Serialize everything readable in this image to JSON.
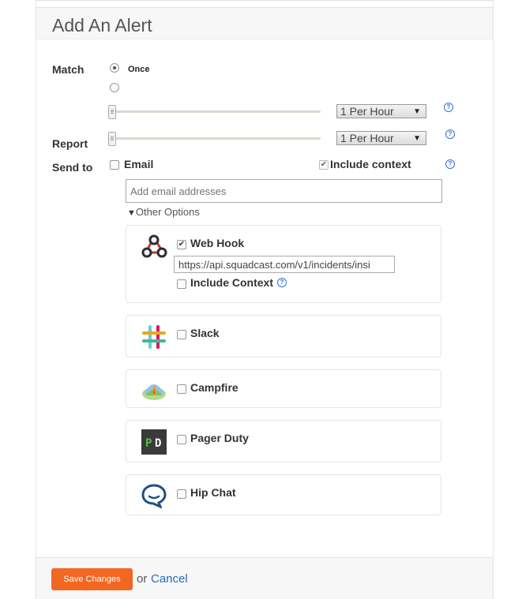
{
  "page": {
    "title": "Add An Alert"
  },
  "match": {
    "label": "Match",
    "option_once": "Once",
    "selected": "once",
    "frequency": "1 Per Hour"
  },
  "report": {
    "label": "Report",
    "frequency": "1 Per Hour"
  },
  "send_to": {
    "label": "Send to",
    "email_label": "Email",
    "include_context_label": "Include context",
    "email_placeholder": "Add email addresses",
    "other_options_label": "Other Options"
  },
  "integrations": {
    "webhook": {
      "name": "Web Hook",
      "checked": true,
      "url": "https://api.squadcast.com/v1/incidents/insi",
      "include_context_label": "Include Context"
    },
    "slack": {
      "name": "Slack"
    },
    "campfire": {
      "name": "Campfire"
    },
    "pagerduty": {
      "name": "Pager Duty"
    },
    "hipchat": {
      "name": "Hip Chat"
    }
  },
  "footer": {
    "save_label": "Save Changes",
    "or_text": "or",
    "cancel_label": "Cancel"
  },
  "colors": {
    "accent": "#f26722",
    "link": "#2a6ab8",
    "help": "#3a6fd8"
  }
}
